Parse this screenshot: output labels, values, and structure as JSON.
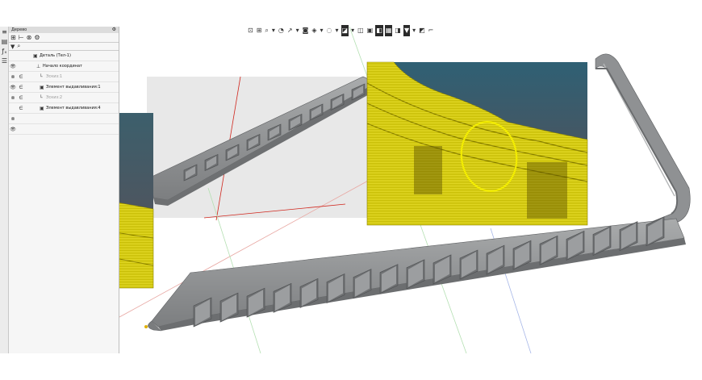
{
  "tree_panel": {
    "title": "Дерево",
    "filter_placeholder": "",
    "rows": [
      {
        "label": "Деталь (Тел-1)",
        "eye": "",
        "rel": "",
        "icon": "▣",
        "dim": false,
        "indent": 30
      },
      {
        "label": "Начало координат",
        "eye": "👁",
        "rel": "",
        "icon": "⊥",
        "dim": false,
        "indent": 34
      },
      {
        "label": "Эскиз:1",
        "eye": "⊗",
        "rel": "∈",
        "icon": "└",
        "dim": true,
        "indent": 38
      },
      {
        "label": "Элемент выдавливания:1",
        "eye": "👁",
        "rel": "∈",
        "icon": "▣",
        "dim": false,
        "indent": 38
      },
      {
        "label": "Эскиз:2",
        "eye": "⊗",
        "rel": "∈",
        "icon": "└",
        "dim": true,
        "indent": 38
      },
      {
        "label": "Элемент выдавливания:4",
        "eye": "",
        "rel": "∈",
        "icon": "▣",
        "dim": false,
        "indent": 38
      },
      {
        "label": "",
        "eye": "⊗",
        "rel": "",
        "icon": "",
        "dim": true,
        "indent": 38
      },
      {
        "label": "",
        "eye": "👁",
        "rel": "",
        "icon": "",
        "dim": true,
        "indent": 38
      }
    ]
  },
  "left_strip": [
    "≡",
    "▤",
    "ƒₓ",
    "☰"
  ],
  "toolbar_icons": [
    "⊡",
    "⊞",
    "⌕",
    "▾",
    "◔",
    "↗",
    "▾",
    "◙",
    "◈",
    "▾",
    "◌",
    "▾",
    "◪",
    "▾",
    "◫",
    "▣",
    "◧",
    "▦",
    "◨",
    "▼",
    "▾",
    "◩",
    "⌐"
  ],
  "colors": {
    "filament_yellow": "#c9c000",
    "part_gray": "#8d8f90",
    "highlight_circle": "#f2ec00",
    "axis_red": "#d0261d",
    "axis_green": "#3fb83a",
    "axis_blue": "#2230c9"
  }
}
